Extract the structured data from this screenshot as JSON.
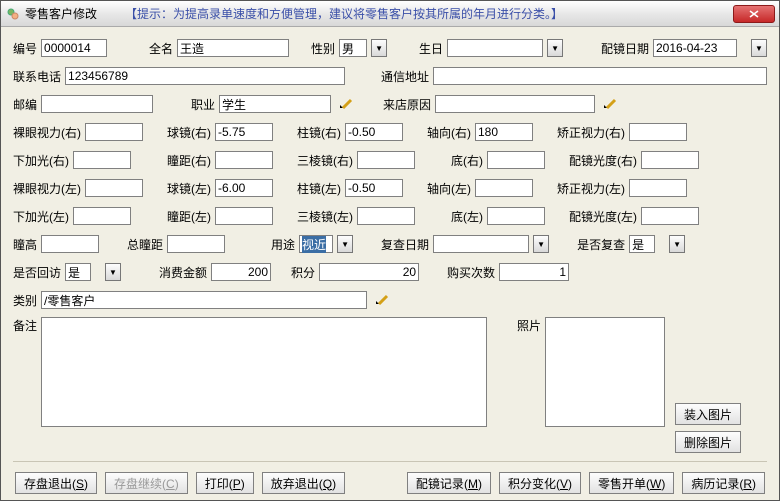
{
  "titlebar": {
    "title": "零售客户修改",
    "tip": "【提示：为提高录单速度和方便管理，建议将零售客户按其所属的年月进行分类。】"
  },
  "labels": {
    "id": "编号",
    "name": "全名",
    "sex": "性别",
    "birthday": "生日",
    "fitdate": "配镜日期",
    "phone": "联系电话",
    "addr": "通信地址",
    "zip": "邮编",
    "job": "职业",
    "reason": "来店原因",
    "nvR": "裸眼视力(右)",
    "sphR": "球镜(右)",
    "cylR": "柱镜(右)",
    "axisR": "轴向(右)",
    "cvaR": "矫正视力(右)",
    "addR": "下加光(右)",
    "pdR": "瞳距(右)",
    "prismR": "三棱镜(右)",
    "baseR": "底(右)",
    "ldR": "配镜光度(右)",
    "nvL": "裸眼视力(左)",
    "sphL": "球镜(左)",
    "cylL": "柱镜(左)",
    "axisL": "轴向(左)",
    "cvaL": "矫正视力(左)",
    "addL": "下加光(左)",
    "pdL": "瞳距(左)",
    "prismL": "三棱镜(左)",
    "baseL": "底(左)",
    "ldL": "配镜光度(左)",
    "ph": "瞳高",
    "totalpd": "总瞳距",
    "use": "用途",
    "recheck": "复查日期",
    "isrecheck": "是否复查",
    "callback": "是否回访",
    "amount": "消费金额",
    "points": "积分",
    "buytimes": "购买次数",
    "category": "类别",
    "notes": "备注",
    "photo": "照片"
  },
  "values": {
    "id": "0000014",
    "name": "王造",
    "sex": "男",
    "birthday": "",
    "fitdate": "2016-04-23",
    "phone": "123456789",
    "addr": "",
    "zip": "",
    "job": "学生",
    "reason": "",
    "nvR": "",
    "sphR": "-5.75",
    "cylR": "-0.50",
    "axisR": "180",
    "cvaR": "",
    "addR": "",
    "pdR": "",
    "prismR": "",
    "baseR": "",
    "ldR": "",
    "nvL": "",
    "sphL": "-6.00",
    "cylL": "-0.50",
    "axisL": "",
    "cvaL": "",
    "addL": "",
    "pdL": "",
    "prismL": "",
    "baseL": "",
    "ldL": "",
    "ph": "",
    "totalpd": "",
    "use": "视近",
    "recheck": "",
    "isrecheck": "是",
    "callback": "是",
    "amount": "200",
    "points": "20",
    "buytimes": "1",
    "category": "/零售客户",
    "notes": ""
  },
  "buttons": {
    "loadphoto": "装入图片",
    "delphoto": "删除图片",
    "saveexit": "存盘退出",
    "savecont": "存盘继续",
    "print": "打印",
    "abandon": "放弃退出",
    "fitrec": "配镜记录",
    "pointchg": "积分变化",
    "saleord": "零售开单",
    "history": "病历记录"
  },
  "mnemonics": {
    "saveexit": "S",
    "savecont": "C",
    "print": "P",
    "abandon": "Q",
    "fitrec": "M",
    "pointchg": "V",
    "saleord": "W",
    "history": "R"
  }
}
